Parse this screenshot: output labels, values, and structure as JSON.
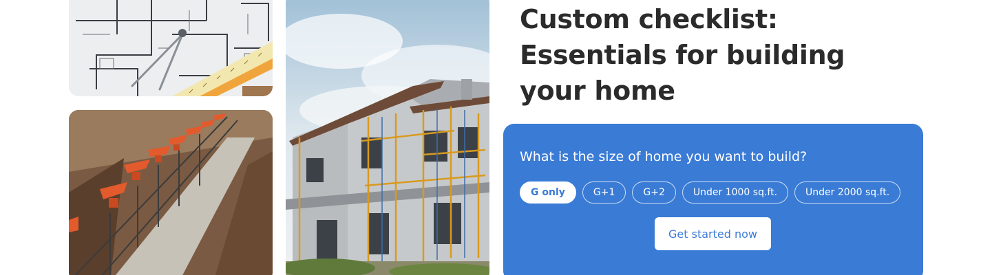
{
  "headline": {
    "line1": "Custom checklist:",
    "line2": "Essentials for building",
    "line3": "your home"
  },
  "card": {
    "question": "What is the size of home you want to build?",
    "options": [
      {
        "label": "G only",
        "selected": true
      },
      {
        "label": "G+1",
        "selected": false
      },
      {
        "label": "G+2",
        "selected": false
      },
      {
        "label": "Under 1000 sq.ft.",
        "selected": false
      },
      {
        "label": "Under 2000 sq.ft.",
        "selected": false
      }
    ],
    "cta_label": "Get started now"
  },
  "colors": {
    "card_bg": "#3a7bd5",
    "headline": "#2b2b2b",
    "white": "#ffffff"
  },
  "images": [
    "blueprint-photo",
    "foundation-photo",
    "house-construction-photo"
  ]
}
